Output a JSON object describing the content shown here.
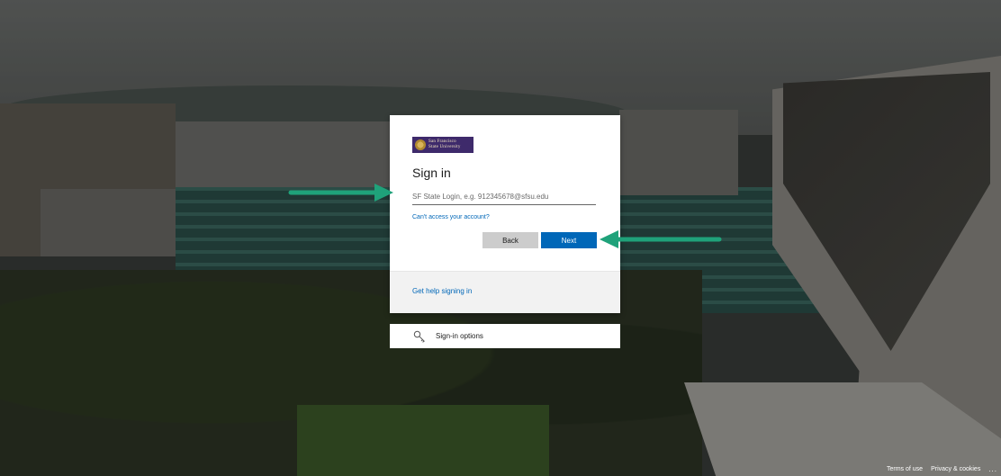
{
  "brand": {
    "logo_text_line1": "San Francisco",
    "logo_text_line2": "State University"
  },
  "signin": {
    "title": "Sign in",
    "login_placeholder": "SF State Login, e.g. 912345678@sfsu.edu",
    "login_value": "",
    "cant_access_link": "Can't access your account?",
    "back_button": "Back",
    "next_button": "Next",
    "help_link": "Get help signing in"
  },
  "signin_options": {
    "label": "Sign-in options",
    "icon": "key-icon"
  },
  "footer": {
    "terms": "Terms of use",
    "privacy": "Privacy & cookies",
    "more": "..."
  },
  "colors": {
    "accent": "#0067b8",
    "logo_bg": "#3e2a6b",
    "arrow": "#1fa27a"
  }
}
